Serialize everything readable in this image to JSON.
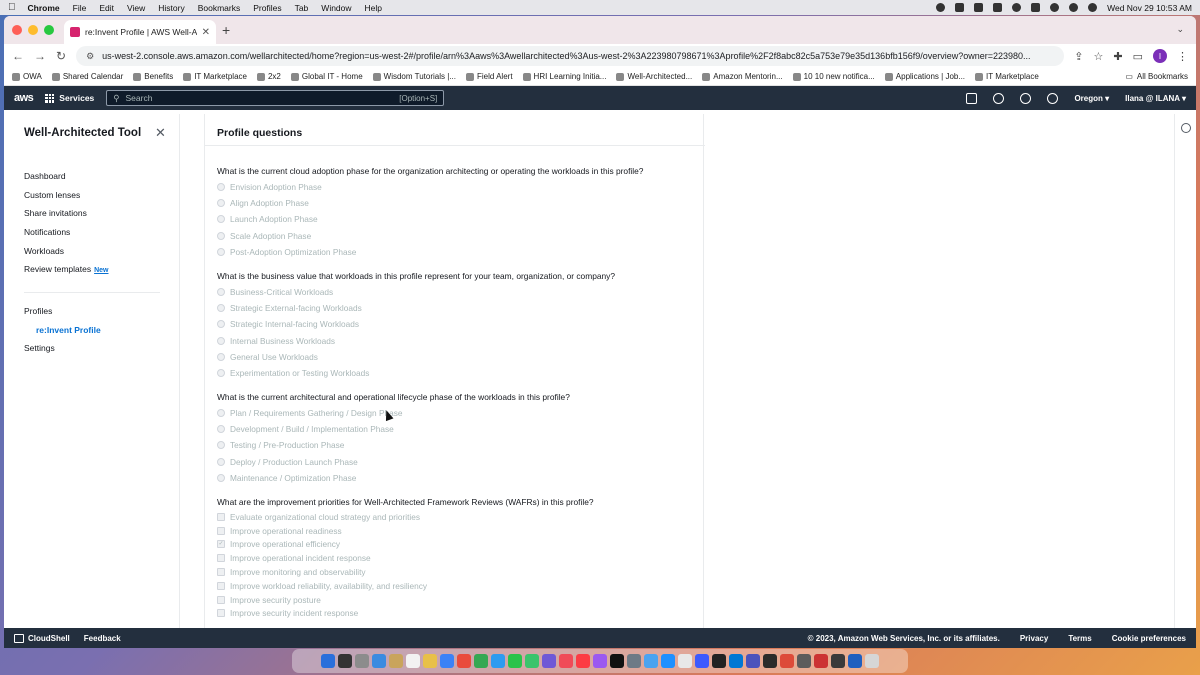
{
  "menubar": {
    "app": "Chrome",
    "items": [
      "File",
      "Edit",
      "View",
      "History",
      "Bookmarks",
      "Profiles",
      "Tab",
      "Window",
      "Help"
    ],
    "clock": "Wed Nov 29  10:53 AM"
  },
  "browser": {
    "tab_title": "re:Invent Profile | AWS Well-A",
    "url": "us-west-2.console.aws.amazon.com/wellarchitected/home?region=us-west-2#/profile/arn%3Aaws%3Awellarchitected%3Aus-west-2%3A223980798671%3Aprofile%2F2f8abc82c5a753e79e35d136bfb156f9/overview?owner=223980...",
    "profile_initial": "I",
    "bookmarks": [
      "OWA",
      "Shared Calendar",
      "Benefits",
      "IT Marketplace",
      "2x2",
      "Global IT - Home",
      "Wisdom Tutorials |...",
      "Field Alert",
      "HRI Learning Initia...",
      "Well-Architected...",
      "Amazon Mentorin...",
      "10 10 new notifica...",
      "Applications | Job...",
      "IT Marketplace"
    ],
    "all_bookmarks": "All Bookmarks"
  },
  "aws_header": {
    "logo": "aws",
    "services": "Services",
    "search_placeholder": "Search",
    "search_shortcut": "[Option+S]",
    "region": "Oregon ▾",
    "account": "Ilana @ ILANA ▾"
  },
  "sidenav": {
    "title": "Well-Architected Tool",
    "items": [
      {
        "label": "Dashboard"
      },
      {
        "label": "Custom lenses"
      },
      {
        "label": "Share invitations"
      },
      {
        "label": "Notifications"
      },
      {
        "label": "Workloads"
      },
      {
        "label": "Review templates",
        "badge": "New"
      }
    ],
    "profiles_label": "Profiles",
    "active_profile": "re:Invent Profile",
    "settings_label": "Settings"
  },
  "content": {
    "heading": "Profile questions",
    "questions": [
      {
        "text": "What is the current cloud adoption phase for the organization architecting or operating the workloads in this profile?",
        "options": [
          "Envision Adoption Phase",
          "Align Adoption Phase",
          "Launch Adoption Phase",
          "Scale Adoption Phase",
          "Post-Adoption Optimization Phase"
        ]
      },
      {
        "text": "What is the business value that workloads in this profile represent for your team, organization, or company?",
        "options": [
          "Business-Critical Workloads",
          "Strategic External-facing Workloads",
          "Strategic Internal-facing Workloads",
          "Internal Business Workloads",
          "General Use Workloads",
          "Experimentation or Testing Workloads"
        ]
      },
      {
        "text": "What is the current architectural and operational lifecycle phase of the workloads in this profile?",
        "options": [
          "Plan / Requirements Gathering / Design Phase",
          "Development / Build / Implementation Phase",
          "Testing / Pre-Production Phase",
          "Deploy / Production Launch Phase",
          "Maintenance / Optimization Phase"
        ]
      },
      {
        "text": "What are the improvement priorities for Well-Architected Framework Reviews (WAFRs) in this profile?",
        "options": [
          "Evaluate organizational cloud strategy and priorities",
          "Improve operational readiness",
          "Improve operational efficiency",
          "Improve operational incident response",
          "Improve monitoring and observability",
          "Improve workload reliability, availability, and resiliency",
          "Improve security posture",
          "Improve security incident response"
        ]
      }
    ]
  },
  "footer": {
    "cloudshell": "CloudShell",
    "feedback": "Feedback",
    "copyright": "© 2023, Amazon Web Services, Inc. or its affiliates.",
    "privacy": "Privacy",
    "terms": "Terms",
    "cookies": "Cookie preferences"
  }
}
